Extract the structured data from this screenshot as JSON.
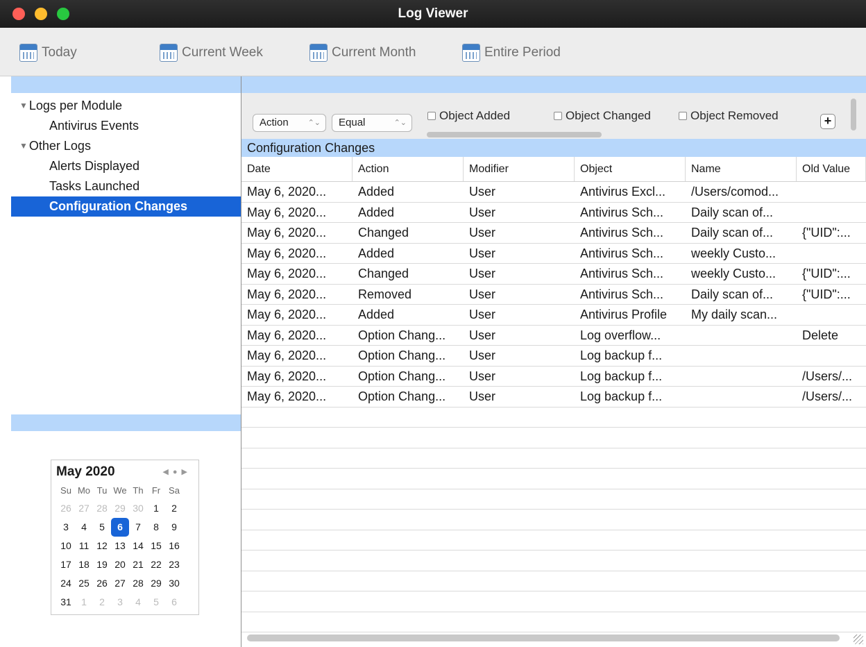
{
  "window": {
    "title": "Log Viewer"
  },
  "toolbar": {
    "today": "Today",
    "current_week": "Current Week",
    "current_month": "Current Month",
    "entire_period": "Entire Period"
  },
  "sidebar": {
    "groups": [
      {
        "label": "Logs per Module",
        "items": [
          "Antivirus Events"
        ]
      },
      {
        "label": "Other Logs",
        "items": [
          "Alerts Displayed",
          "Tasks Launched",
          "Configuration Changes"
        ]
      }
    ],
    "selected": "Configuration Changes"
  },
  "calendar": {
    "month_label": "May 2020",
    "weekdays": [
      "Su",
      "Mo",
      "Tu",
      "We",
      "Th",
      "Fr",
      "Sa"
    ],
    "weeks": [
      [
        "26",
        "27",
        "28",
        "29",
        "30",
        "1",
        "2"
      ],
      [
        "3",
        "4",
        "5",
        "6",
        "7",
        "8",
        "9"
      ],
      [
        "10",
        "11",
        "12",
        "13",
        "14",
        "15",
        "16"
      ],
      [
        "17",
        "18",
        "19",
        "20",
        "21",
        "22",
        "23"
      ],
      [
        "24",
        "25",
        "26",
        "27",
        "28",
        "29",
        "30"
      ],
      [
        "31",
        "1",
        "2",
        "3",
        "4",
        "5",
        "6"
      ]
    ],
    "selected_day": "6"
  },
  "filter": {
    "field": "Action",
    "operator": "Equal",
    "checkboxes": [
      "Object Added",
      "Object Changed",
      "Object Removed"
    ],
    "add_label": "+"
  },
  "section_title": "Configuration Changes",
  "table": {
    "columns": [
      "Date",
      "Action",
      "Modifier",
      "Object",
      "Name",
      "Old Value"
    ],
    "rows": [
      [
        "May 6, 2020...",
        "Added",
        "User",
        "Antivirus Excl...",
        "/Users/comod...",
        ""
      ],
      [
        "May 6, 2020...",
        "Added",
        "User",
        "Antivirus Sch...",
        "Daily scan of...",
        ""
      ],
      [
        "May 6, 2020...",
        "Changed",
        "User",
        "Antivirus Sch...",
        "Daily scan of...",
        "{\"UID\":..."
      ],
      [
        "May 6, 2020...",
        "Added",
        "User",
        "Antivirus Sch...",
        "weekly Custo...",
        ""
      ],
      [
        "May 6, 2020...",
        "Changed",
        "User",
        "Antivirus Sch...",
        "weekly Custo...",
        "{\"UID\":..."
      ],
      [
        "May 6, 2020...",
        "Removed",
        "User",
        "Antivirus Sch...",
        "Daily scan of...",
        "{\"UID\":..."
      ],
      [
        "May 6, 2020...",
        "Added",
        "User",
        "Antivirus Profile",
        "My daily scan...",
        ""
      ],
      [
        "May 6, 2020...",
        "Option Chang...",
        "User",
        "Log overflow...",
        "",
        "Delete"
      ],
      [
        "May 6, 2020...",
        "Option Chang...",
        "User",
        "Log backup f...",
        "",
        ""
      ],
      [
        "May 6, 2020...",
        "Option Chang...",
        "User",
        "Log backup f...",
        "",
        "/Users/..."
      ],
      [
        "May 6, 2020...",
        "Option Chang...",
        "User",
        "Log backup f...",
        "",
        "/Users/..."
      ]
    ]
  },
  "colors": {
    "accent": "#1864d7",
    "section_bg": "#b7d7fb"
  }
}
